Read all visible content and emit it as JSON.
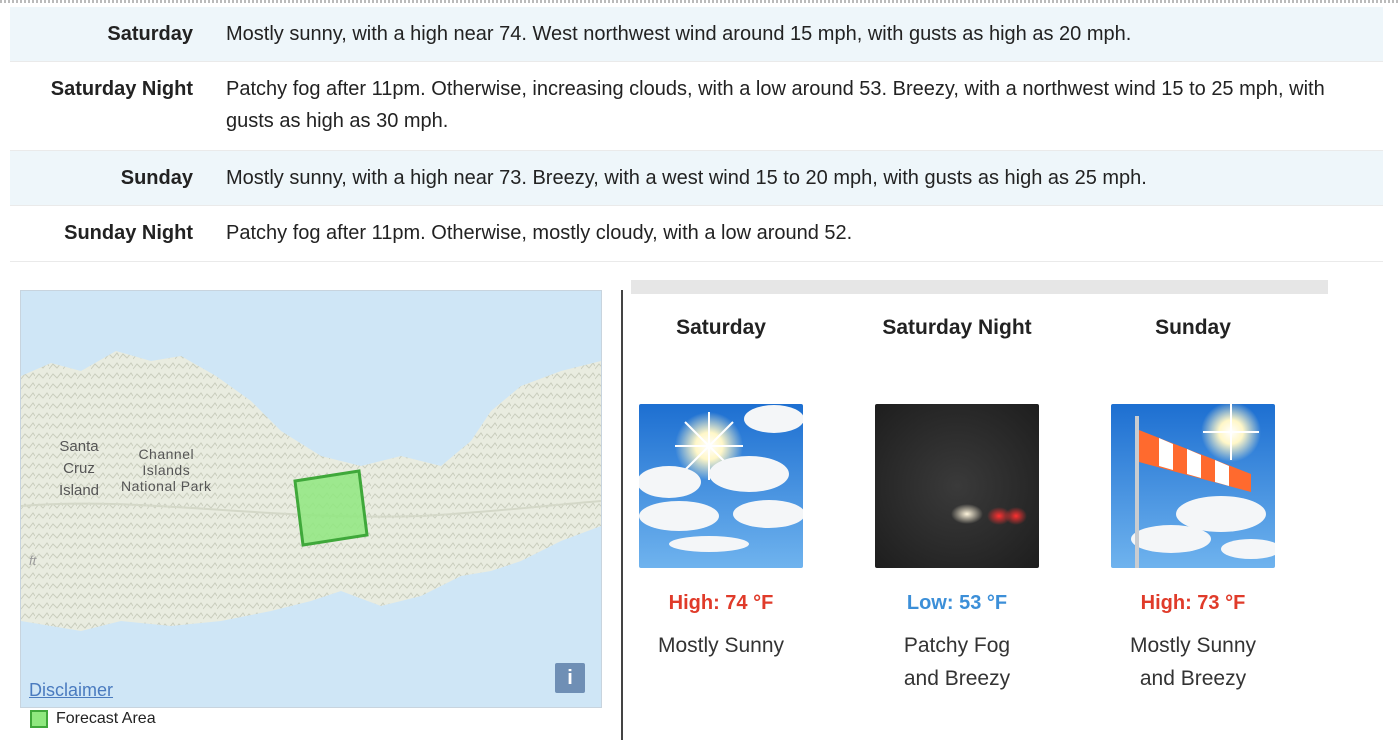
{
  "detailed_forecast": [
    {
      "label": "Saturday",
      "text": "Mostly sunny, with a high near 74. West northwest wind around 15 mph, with gusts as high as 20 mph."
    },
    {
      "label": "Saturday Night",
      "text": "Patchy fog after 11pm. Otherwise, increasing clouds, with a low around 53. Breezy, with a northwest wind 15 to 25 mph, with gusts as high as 30 mph."
    },
    {
      "label": "Sunday",
      "text": "Mostly sunny, with a high near 73. Breezy, with a west wind 15 to 20 mph, with gusts as high as 25 mph."
    },
    {
      "label": "Sunday Night",
      "text": "Patchy fog after 11pm. Otherwise, mostly cloudy, with a low around 52."
    }
  ],
  "map": {
    "labels": {
      "santa_cruz": "Santa\nCruz\nIsland",
      "channel_islands": "Channel\nIslands\nNational Park",
      "ft": "ft"
    },
    "disclaimer": "Disclaimer",
    "info": "i",
    "legend": "Forecast Area"
  },
  "periods": [
    {
      "name": "Saturday",
      "temp": "High: 74 °F",
      "temp_kind": "high",
      "desc": "Mostly Sunny",
      "icon": "sunny-clouds-icon"
    },
    {
      "name": "Saturday Night",
      "temp": "Low: 53 °F",
      "temp_kind": "low",
      "desc": "Patchy Fog and Breezy",
      "icon": "fog-night-icon"
    },
    {
      "name": "Sunday",
      "temp": "High: 73 °F",
      "temp_kind": "high",
      "desc": "Mostly Sunny and Breezy",
      "icon": "windsock-sunny-icon"
    }
  ],
  "colors": {
    "high": "#e03b2a",
    "low": "#3c8fd8",
    "row_shade": "#eef6fa",
    "forecast_area": "#8fe87f"
  }
}
